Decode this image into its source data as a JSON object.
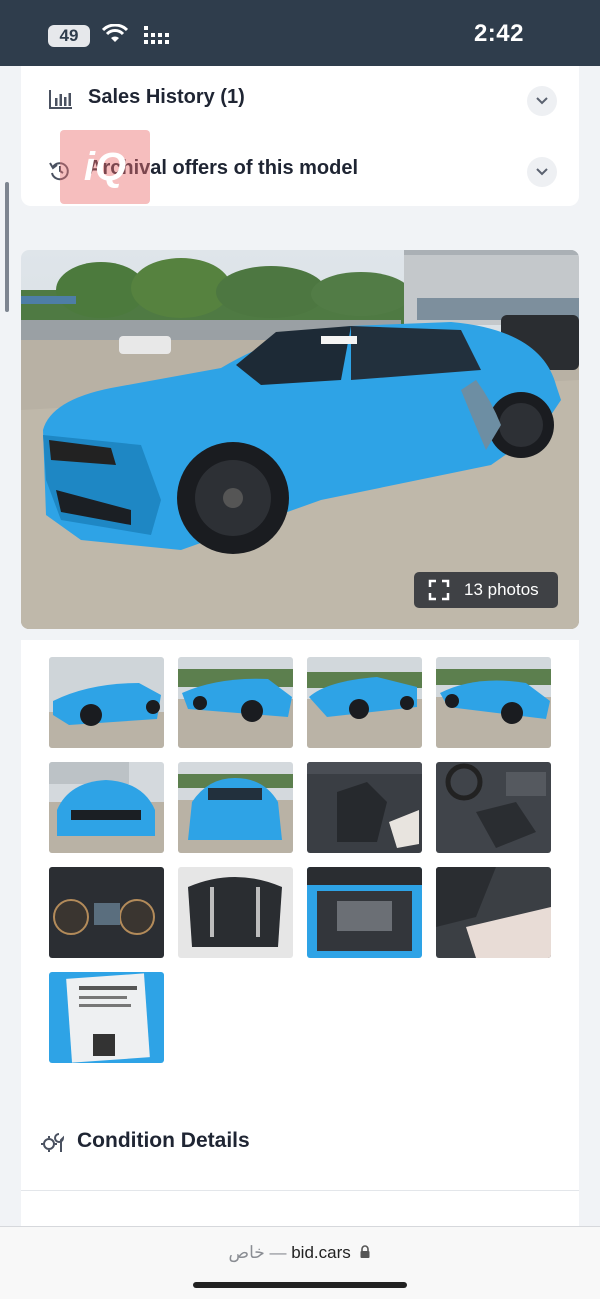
{
  "status_bar": {
    "battery": "49",
    "time": "2:42"
  },
  "sections": {
    "sales_history": "Sales History (1)",
    "archival": "Archival offers of this model"
  },
  "watermark": "iQ",
  "gallery": {
    "photo_count_label": "13 photos"
  },
  "condition": {
    "title": "Condition Details"
  },
  "browser": {
    "private_label": "خاص — ",
    "domain": "bid.cars"
  },
  "colors": {
    "car_blue": "#2ea3e6",
    "status_bar": "#2f3d4c"
  },
  "icons": [
    "chart-icon",
    "history-icon",
    "chevron-down-icon",
    "expand-icon",
    "wrench-gear-icon",
    "lock-icon",
    "wifi-icon",
    "signal-icon"
  ]
}
